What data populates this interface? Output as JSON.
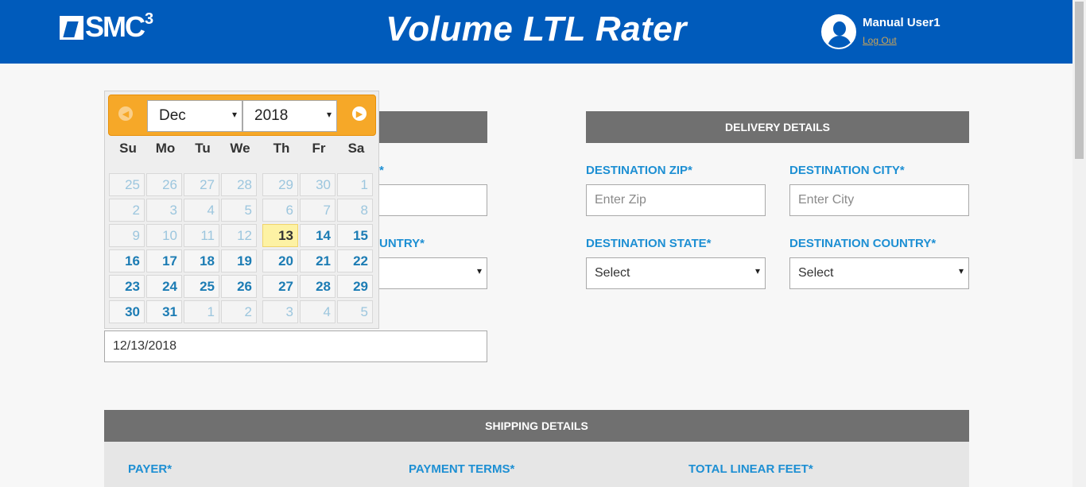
{
  "header": {
    "logo_text": "SMC",
    "logo_sup": "3",
    "title": "Volume LTL Rater",
    "user_name": "Manual User1",
    "logout": "Log Out"
  },
  "origin": {
    "zip_label_partial": "*",
    "country_label_partial": "UNTRY*",
    "pickup_date": "12/13/2018"
  },
  "delivery": {
    "header": "DELIVERY DETAILS",
    "zip_label": "DESTINATION ZIP*",
    "zip_placeholder": "Enter Zip",
    "city_label": "DESTINATION CITY*",
    "city_placeholder": "Enter City",
    "state_label": "DESTINATION STATE*",
    "state_value": "Select",
    "country_label": "DESTINATION COUNTRY*",
    "country_value": "Select"
  },
  "shipping": {
    "header": "SHIPPING DETAILS",
    "payer_label": "PAYER*",
    "terms_label": "PAYMENT TERMS*",
    "feet_label": "TOTAL LINEAR FEET*"
  },
  "datepicker": {
    "month": "Dec",
    "year": "2018",
    "prev_icon": "prev-arrow-icon",
    "next_icon": "next-arrow-icon",
    "weekdays": [
      "Su",
      "Mo",
      "Tu",
      "We",
      "Th",
      "Fr",
      "Sa"
    ],
    "weeks": [
      [
        {
          "d": "25",
          "s": "other"
        },
        {
          "d": "26",
          "s": "other"
        },
        {
          "d": "27",
          "s": "other"
        },
        {
          "d": "28",
          "s": "other"
        },
        {
          "d": "29",
          "s": "other"
        },
        {
          "d": "30",
          "s": "other"
        },
        {
          "d": "1",
          "s": "past"
        }
      ],
      [
        {
          "d": "2",
          "s": "past"
        },
        {
          "d": "3",
          "s": "past"
        },
        {
          "d": "4",
          "s": "past"
        },
        {
          "d": "5",
          "s": "past"
        },
        {
          "d": "6",
          "s": "past"
        },
        {
          "d": "7",
          "s": "past"
        },
        {
          "d": "8",
          "s": "past"
        }
      ],
      [
        {
          "d": "9",
          "s": "past"
        },
        {
          "d": "10",
          "s": "past"
        },
        {
          "d": "11",
          "s": "past"
        },
        {
          "d": "12",
          "s": "past"
        },
        {
          "d": "13",
          "s": "today"
        },
        {
          "d": "14",
          "s": "active"
        },
        {
          "d": "15",
          "s": "active"
        }
      ],
      [
        {
          "d": "16",
          "s": "active"
        },
        {
          "d": "17",
          "s": "active"
        },
        {
          "d": "18",
          "s": "active"
        },
        {
          "d": "19",
          "s": "active"
        },
        {
          "d": "20",
          "s": "active"
        },
        {
          "d": "21",
          "s": "active"
        },
        {
          "d": "22",
          "s": "active"
        }
      ],
      [
        {
          "d": "23",
          "s": "active"
        },
        {
          "d": "24",
          "s": "active"
        },
        {
          "d": "25",
          "s": "active"
        },
        {
          "d": "26",
          "s": "active"
        },
        {
          "d": "27",
          "s": "active"
        },
        {
          "d": "28",
          "s": "active"
        },
        {
          "d": "29",
          "s": "active"
        }
      ],
      [
        {
          "d": "30",
          "s": "active"
        },
        {
          "d": "31",
          "s": "active"
        },
        {
          "d": "1",
          "s": "other"
        },
        {
          "d": "2",
          "s": "other"
        },
        {
          "d": "3",
          "s": "other"
        },
        {
          "d": "4",
          "s": "other"
        },
        {
          "d": "5",
          "s": "other"
        }
      ]
    ]
  }
}
